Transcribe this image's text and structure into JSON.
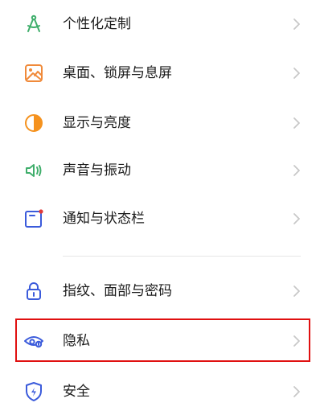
{
  "settings": {
    "items": [
      {
        "label": "个性化定制",
        "icon": "compass-drafting-icon",
        "icon_color": "#3fae6b"
      },
      {
        "label": "桌面、锁屏与息屏",
        "icon": "wallpaper-icon",
        "icon_color": "#f08a3a"
      },
      {
        "label": "显示与亮度",
        "icon": "brightness-icon",
        "icon_color": "#f5921e"
      },
      {
        "label": "声音与振动",
        "icon": "speaker-vibrate-icon",
        "icon_color": "#3fae6b"
      },
      {
        "label": "通知与状态栏",
        "icon": "notification-icon",
        "icon_color": "#3b5bdb"
      },
      {
        "label": "指纹、面部与密码",
        "icon": "lock-icon",
        "icon_color": "#3b5bdb"
      },
      {
        "label": "隐私",
        "icon": "privacy-eye-icon",
        "icon_color": "#3b5bdb"
      },
      {
        "label": "安全",
        "icon": "shield-icon",
        "icon_color": "#3b5bdb"
      }
    ]
  },
  "highlight_color": "#e01010",
  "chevron_color": "#c8c8c8"
}
